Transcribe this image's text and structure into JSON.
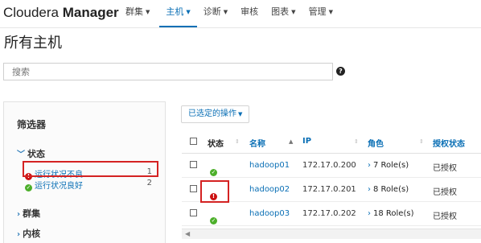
{
  "brand": {
    "name": "Cloudera",
    "bold": "Manager"
  },
  "nav": [
    {
      "label": "群集",
      "caret": true
    },
    {
      "label": "主机",
      "caret": true,
      "active": true
    },
    {
      "label": "诊断",
      "caret": true
    },
    {
      "label": "审核",
      "caret": false
    },
    {
      "label": "图表",
      "caret": true
    },
    {
      "label": "管理",
      "caret": true
    }
  ],
  "page_title": "所有主机",
  "search": {
    "placeholder": "搜索"
  },
  "filters": {
    "title": "筛选器",
    "status_section": "状态",
    "items": [
      {
        "label": "运行状况不良",
        "count": "1",
        "status": "bad"
      },
      {
        "label": "运行状况良好",
        "count": "2",
        "status": "good"
      }
    ],
    "cluster_section": "群集",
    "kernel_section": "内核"
  },
  "actions_button": "已选定的操作",
  "table": {
    "headers": {
      "status": "状态",
      "name": "名称",
      "ip": "IP",
      "roles": "角色",
      "auth": "授权状态"
    },
    "rows": [
      {
        "name": "hadoop01",
        "ip": "172.17.0.200",
        "roles": "7 Role(s)",
        "auth": "已授权",
        "status": "good"
      },
      {
        "name": "hadoop02",
        "ip": "172.17.0.201",
        "roles": "8 Role(s)",
        "auth": "已授权",
        "status": "bad"
      },
      {
        "name": "hadoop03",
        "ip": "172.17.0.202",
        "roles": "18 Role(s)",
        "auth": "已授权",
        "status": "good"
      }
    ]
  },
  "colors": {
    "accent": "#0a6fb5",
    "bad": "#cc1111",
    "good": "#4caf2a",
    "highlight": "#d42222"
  }
}
